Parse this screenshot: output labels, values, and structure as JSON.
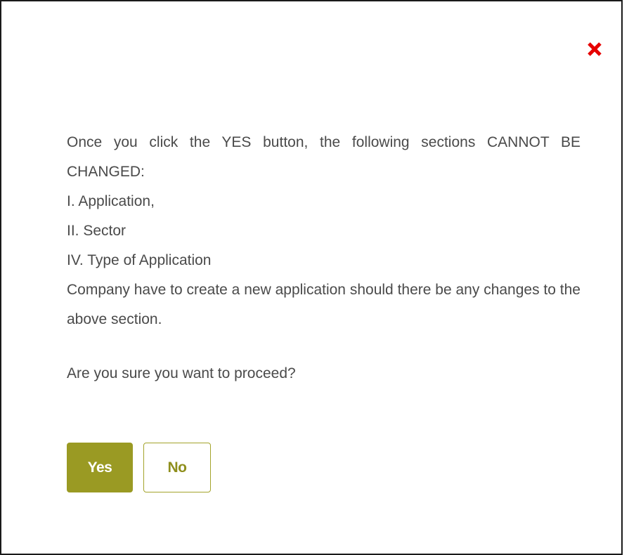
{
  "dialog": {
    "close_icon": "close-x-icon",
    "close_color": "#e60000",
    "message_lines": [
      "Once you click the YES button, the following sections CANNOT BE CHANGED:",
      "I. Application,",
      "II. Sector",
      "IV. Type of Application",
      "Company have to create a new application should there be any changes to the above section."
    ],
    "question": "Are you sure you want to proceed?",
    "yes_label": "Yes",
    "no_label": "No",
    "accent_color": "#9a9a23"
  }
}
